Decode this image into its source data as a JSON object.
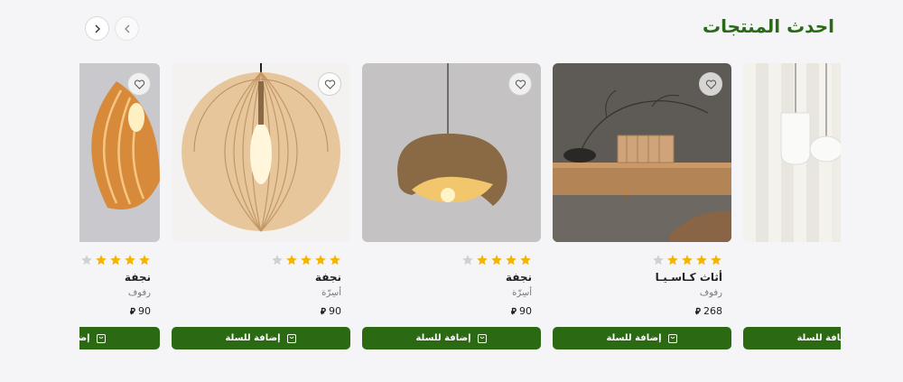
{
  "section": {
    "title": "احدث المنتجات"
  },
  "nav": {
    "next_icon": "chevron-right-icon",
    "prev_icon": "chevron-left-icon"
  },
  "colors": {
    "title": "#2a6a17",
    "button": "#2b6a13",
    "star_filled": "#f4b400",
    "star_empty": "#d0d0d0"
  },
  "products": [
    {
      "name": "",
      "category": "",
      "price": "",
      "rating": 0,
      "button_label": "إضافة للسلة"
    },
    {
      "name": "أثاث كـاسـيـا",
      "category": "رفوف",
      "price": "268",
      "rating": 4,
      "button_label": "إضافة للسلة"
    },
    {
      "name": "نجفة",
      "category": "أسِرّة",
      "price": "90",
      "rating": 4,
      "button_label": "إضافة للسلة"
    },
    {
      "name": "نجفة",
      "category": "أسِرّة",
      "price": "90",
      "rating": 4,
      "button_label": "إضافة للسلة"
    },
    {
      "name": "نجفة",
      "category": "رفوف",
      "price": "90",
      "rating": 4,
      "button_label": "إضافة للسلة"
    }
  ],
  "currency_symbol": "⃁"
}
